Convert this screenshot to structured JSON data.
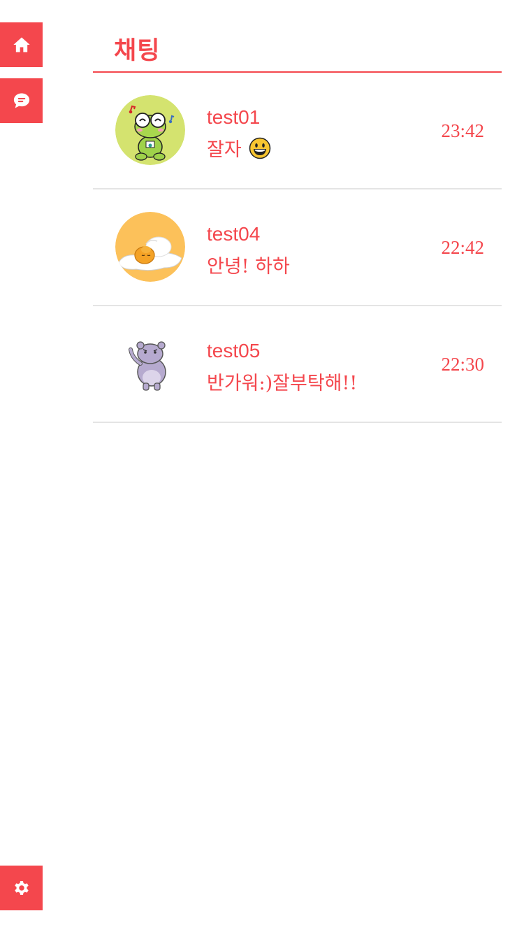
{
  "header": {
    "title": "채팅"
  },
  "sidebar": {
    "home_icon": "home-icon",
    "chat_icon": "chat-bubble-icon",
    "settings_icon": "gear-icon"
  },
  "colors": {
    "accent": "#f4474d",
    "divider": "#e4e4e4"
  },
  "chats": [
    {
      "name": "test01",
      "message": "잘자",
      "emoji": "grinning-face-icon",
      "time": "23:42"
    },
    {
      "name": "test04",
      "message": "안녕! 하하",
      "time": "22:42"
    },
    {
      "name": "test05",
      "message": "반가워:)잘부탁해!!",
      "time": "22:30"
    }
  ]
}
